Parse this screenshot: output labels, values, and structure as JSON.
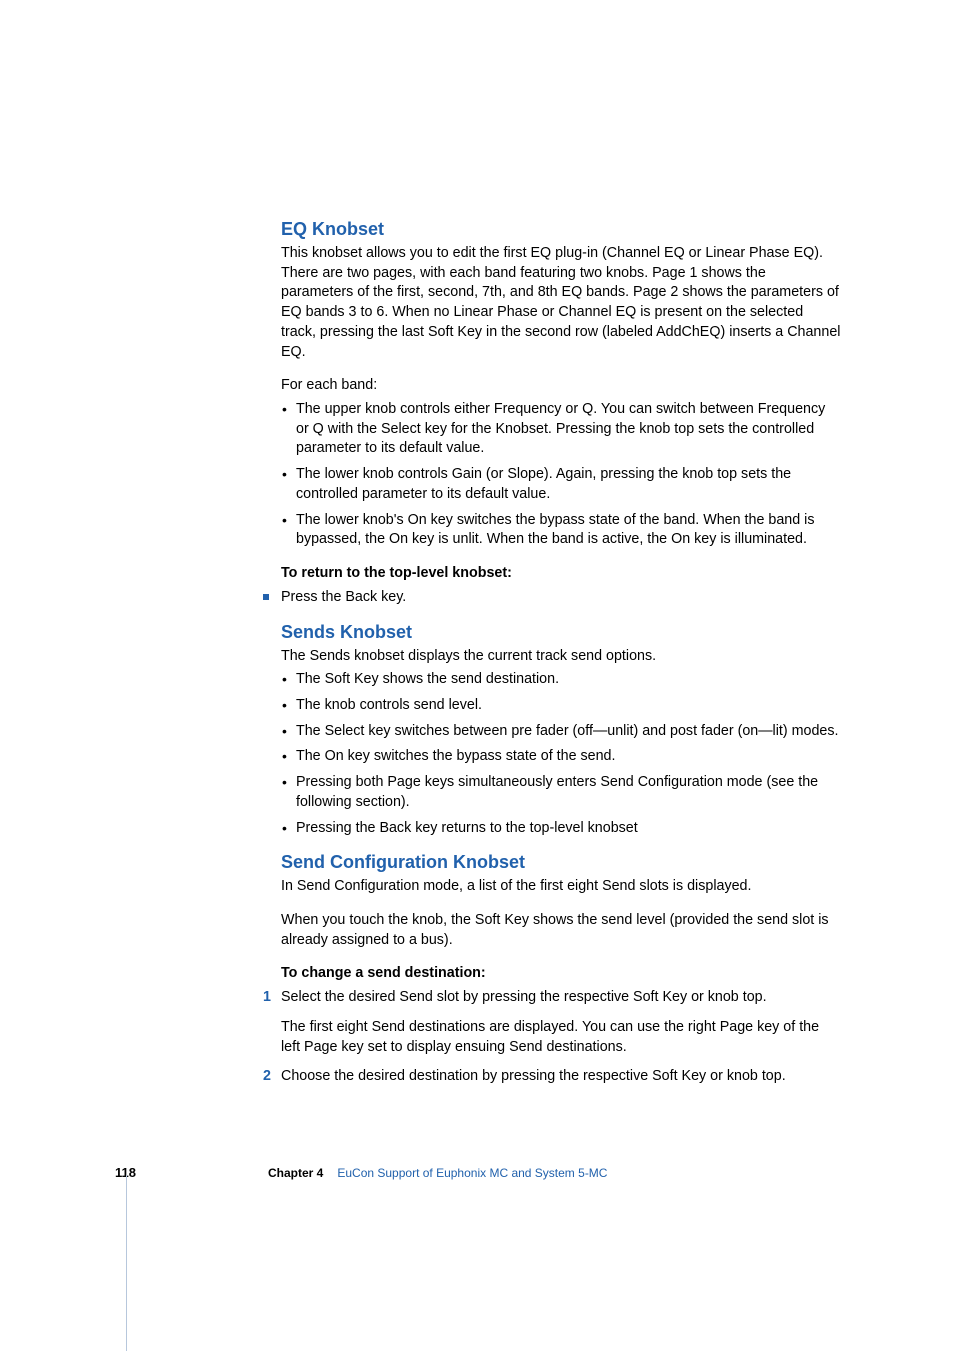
{
  "sections": {
    "eq": {
      "heading": "EQ Knobset",
      "p1": "This knobset allows you to edit the first EQ plug-in (Channel EQ or Linear Phase EQ). There are two pages, with each band featuring two knobs. Page 1 shows the parameters of the first, second, 7th, and 8th EQ bands. Page 2 shows the parameters of EQ bands 3 to 6. When no Linear Phase or Channel EQ is present on the selected track, pressing the last Soft Key in the second row (labeled AddChEQ) inserts a Channel EQ.",
      "p2": "For each band:",
      "bullets": [
        "The upper knob controls either Frequency or Q. You can switch between Frequency or Q with the Select key for the Knobset. Pressing the knob top sets the controlled parameter to its default value.",
        "The lower knob controls Gain (or Slope). Again, pressing the knob top sets the controlled parameter to its default value.",
        "The lower knob's On key switches the bypass state of the band. When the band is bypassed, the On key is unlit. When the band is active, the On key is illuminated."
      ],
      "boldline": "To return to the top-level knobset:",
      "squareitem": "Press the Back key."
    },
    "sends": {
      "heading": "Sends Knobset",
      "p1": "The Sends knobset displays the current track send options.",
      "bullets": [
        "The Soft Key shows the send destination.",
        "The knob controls send level.",
        "The Select key switches between pre fader (off—unlit) and post fader (on—lit) modes.",
        "The On key switches the bypass state of the send.",
        "Pressing both Page keys simultaneously enters Send Configuration mode (see the following section).",
        "Pressing the Back key returns to the top-level knobset"
      ]
    },
    "sendconfig": {
      "heading": "Send Configuration Knobset",
      "p1": "In Send Configuration mode, a list of the first eight Send slots is displayed.",
      "p2": "When you touch the knob, the Soft Key shows the send level (provided the send slot is already assigned to a bus).",
      "boldline": "To change a send destination:",
      "step1": "Select the desired Send slot by pressing the respective Soft Key or knob top.",
      "step1sub": "The first eight Send destinations are displayed. You can use the right Page key of the left Page key set to display ensuing Send destinations.",
      "step2": "Choose the desired destination by pressing the respective Soft Key or knob top."
    }
  },
  "footer": {
    "page": "118",
    "chapter_label": "Chapter 4",
    "chapter_title": "EuCon Support of Euphonix MC and System 5-MC"
  },
  "steps": {
    "n1": "1",
    "n2": "2"
  }
}
